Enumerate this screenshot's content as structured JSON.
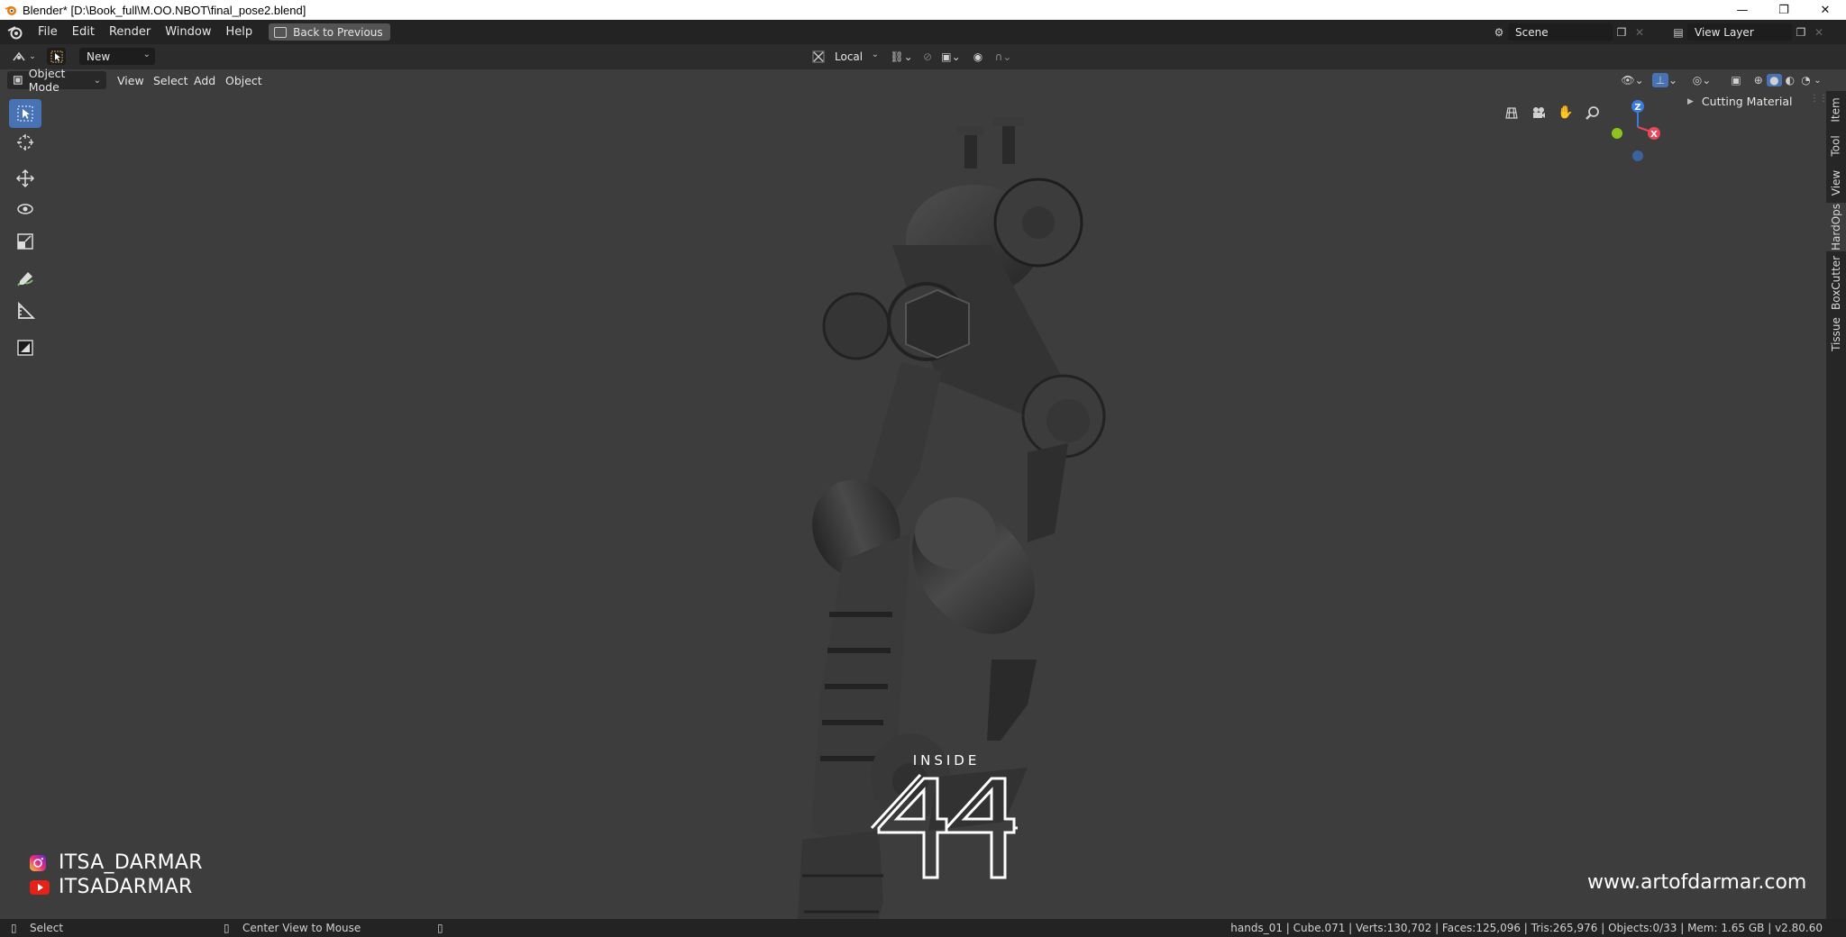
{
  "window": {
    "title": "Blender* [D:\\Book_full\\M.OO.NBOT\\final_pose2.blend]",
    "minimize": "—",
    "maximize": "❐",
    "close": "✕"
  },
  "menubar": {
    "items": [
      "File",
      "Edit",
      "Render",
      "Window",
      "Help"
    ],
    "back_button": "Back to Previous",
    "scene": "Scene",
    "view_layer": "View Layer"
  },
  "tool_header": {
    "new_label": "New",
    "transform_orientation": "Local"
  },
  "viewport_header": {
    "mode": "Object Mode",
    "menus": [
      "View",
      "Select",
      "Add",
      "Object"
    ]
  },
  "gizmo": {
    "z": "Z",
    "x": "X",
    "colors": {
      "x": "#e8485a",
      "y": "#8ec21c",
      "z": "#3a7bdf"
    }
  },
  "sidebar": {
    "panel_header": "Cutting Material",
    "tabs": [
      "Item",
      "Tool",
      "View",
      "HardOps",
      "BoxCutter",
      "Tissue"
    ],
    "active_tab": "HardOps"
  },
  "overlay": {
    "logo_top": "INSIDE",
    "instagram": "ITSA_DARMAR",
    "youtube": "ITSADARMAR",
    "website": "www.artofdarmar.com"
  },
  "statusbar": {
    "left": "Select",
    "middle": "Center View to Mouse",
    "stats": "hands_01 | Cube.071 | Verts:130,702 | Faces:125,096 | Tris:265,976 | Objects:0/33 | Mem: 1.65 GB | v2.80.60"
  },
  "colors": {
    "accent": "#4772b3",
    "viewport_bg": "#3d3d3d",
    "header_bg": "#232323"
  }
}
